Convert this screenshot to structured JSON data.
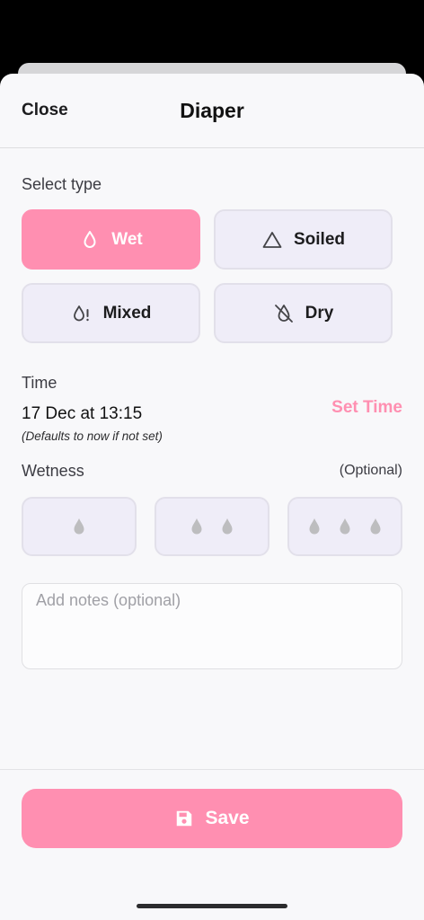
{
  "header": {
    "close_label": "Close",
    "title": "Diaper"
  },
  "type_section": {
    "label": "Select type",
    "selected": "Wet",
    "options": [
      {
        "label": "Wet",
        "icon": "droplet-icon"
      },
      {
        "label": "Soiled",
        "icon": "triangle-icon"
      },
      {
        "label": "Mixed",
        "icon": "droplet-alert-icon"
      },
      {
        "label": "Dry",
        "icon": "droplet-off-icon"
      }
    ]
  },
  "time_section": {
    "label": "Time",
    "value": "17 Dec at 13:15",
    "hint": "(Defaults to now if not set)",
    "set_label": "Set Time"
  },
  "wetness_section": {
    "label": "Wetness",
    "optional_label": "(Optional)",
    "levels": [
      1,
      2,
      3
    ]
  },
  "notes": {
    "placeholder": "Add notes (optional)",
    "value": ""
  },
  "save": {
    "label": "Save",
    "icon": "floppy-disk-icon"
  },
  "colors": {
    "accent": "#ff8fb1",
    "button_bg": "#efedf8",
    "drop_gray": "#bdbdbf"
  }
}
